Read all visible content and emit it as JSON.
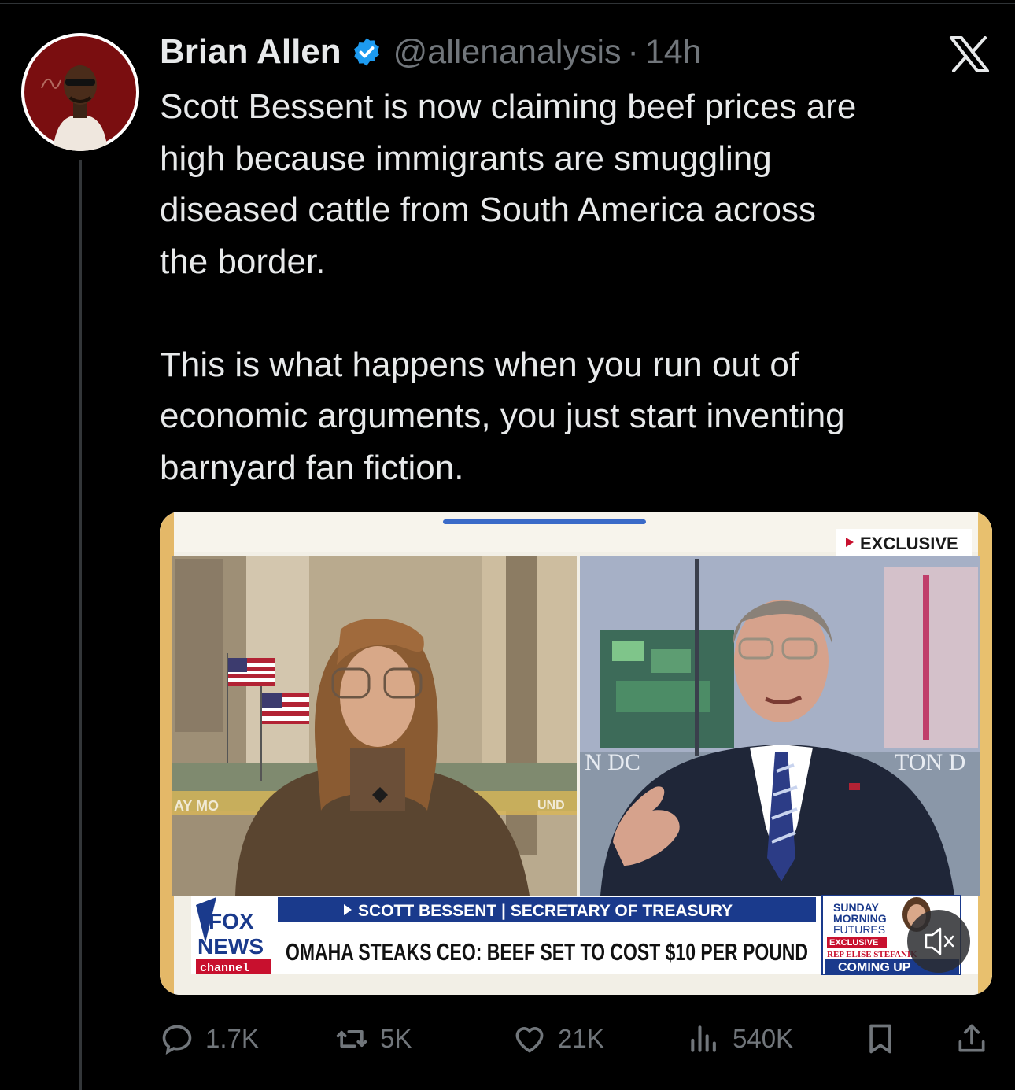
{
  "tweet": {
    "author_name": "Brian Allen",
    "handle": "@allenanalysis",
    "separator": "·",
    "time": "14h",
    "text": "Scott Bessent is now claiming beef prices are\nhigh because immigrants are smuggling\ndiseased cattle from South America across\nthe border.\n\nThis is what happens when you run out of\neconomic arguments, you just start inventing\nbarnyard fan fiction."
  },
  "media": {
    "badge": "EXCLUSIVE",
    "lower_third_name": "SCOTT BESSENT | SECRETARY OF TREASURY",
    "headline": "OMAHA STEAKS CEO: BEEF SET TO COST $10 PER POUND",
    "logo_top": "FOX",
    "logo_bottom": "NEWS",
    "logo_channel": "channel",
    "promo_line1": "SUNDAY",
    "promo_line2": "MORNING",
    "promo_line3": "FUTURES",
    "promo_exclusive": "EXCLUSIVE",
    "promo_guest": "REP ELISE STEFANIK",
    "promo_coming": "COMING UP",
    "backdrop_left": "N DC",
    "backdrop_right": "TON D",
    "left_wall_text": "AY MO",
    "left_wall_text2": "UND"
  },
  "stats": {
    "replies": "1.7K",
    "reposts": "5K",
    "likes": "21K",
    "views": "540K"
  },
  "colors": {
    "background": "#000000",
    "text": "#e7e9ea",
    "muted": "#71767b",
    "verified": "#1d9bf0",
    "fox_blue": "#1a3a8c",
    "fox_red": "#c8102e"
  },
  "icons": [
    "x-logo-icon",
    "verified-badge-icon",
    "reply-icon",
    "repost-icon",
    "like-icon",
    "views-icon",
    "bookmark-icon",
    "share-icon",
    "mute-icon"
  ]
}
